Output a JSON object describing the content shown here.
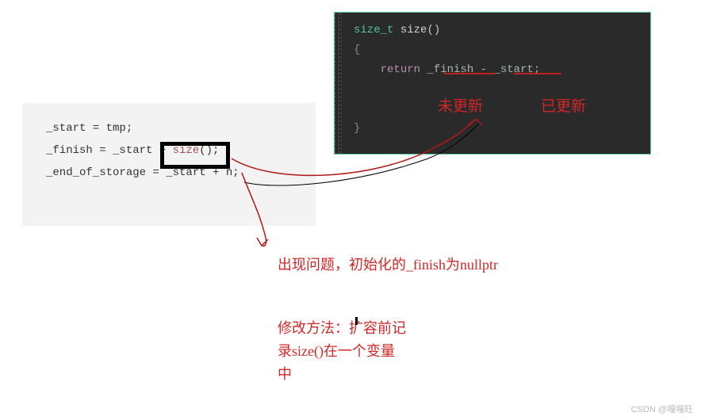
{
  "left_panel": {
    "line1_a": "_start = tmp;",
    "line2_a": "_finish = _start + ",
    "line2_b": "size",
    "line2_c": "();",
    "line3_a": "_end_of_storage = _start + n;"
  },
  "right_panel": {
    "sig_type": "size_t",
    "sig_name": " size",
    "sig_paren": "()",
    "brace_open": "{",
    "ret_indent": "    ",
    "ret_kw": "return",
    "ret_sp": " ",
    "ret_finish": "_finish",
    "ret_minus": " - ",
    "ret_start": "_start",
    "ret_semi": ";",
    "brace_close": "}"
  },
  "annotations": {
    "not_updated": "未更新",
    "updated": "已更新",
    "problem_text": "出现问题，初始化的_finish为nullptr",
    "fix_text_l1": "修改方法：扩容前记",
    "fix_text_l2": "录size()在一个变量",
    "fix_text_l3": "中"
  },
  "watermark": "CSDN @嘎嘎旺"
}
